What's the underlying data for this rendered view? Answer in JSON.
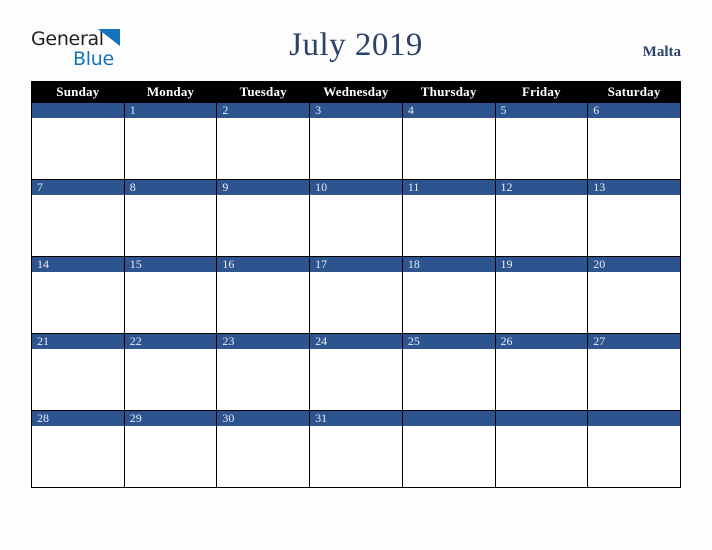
{
  "brand": {
    "line1": "General",
    "line2": "Blue",
    "triangle_icon": "blue-triangle-icon",
    "text_color": "#231f20",
    "accent_color": "#1273bd"
  },
  "header": {
    "title": "July 2019",
    "region": "Malta",
    "title_color": "#2b4369"
  },
  "calendar": {
    "month": "July",
    "year": "2019",
    "weekday_headers": [
      "Sunday",
      "Monday",
      "Tuesday",
      "Wednesday",
      "Thursday",
      "Friday",
      "Saturday"
    ],
    "header_bg_color": "#000000",
    "header_text_color": "#ffffff",
    "date_band_color": "#2e5490",
    "date_text_color": "#e6ebf3",
    "cell_bg_color": "#ffffff",
    "border_color": "#000000",
    "weeks": [
      [
        "",
        "1",
        "2",
        "3",
        "4",
        "5",
        "6"
      ],
      [
        "7",
        "8",
        "9",
        "10",
        "11",
        "12",
        "13"
      ],
      [
        "14",
        "15",
        "16",
        "17",
        "18",
        "19",
        "20"
      ],
      [
        "21",
        "22",
        "23",
        "24",
        "25",
        "26",
        "27"
      ],
      [
        "28",
        "29",
        "30",
        "31",
        "",
        "",
        ""
      ]
    ]
  },
  "page": {
    "background_color": "#fdfdfd"
  }
}
